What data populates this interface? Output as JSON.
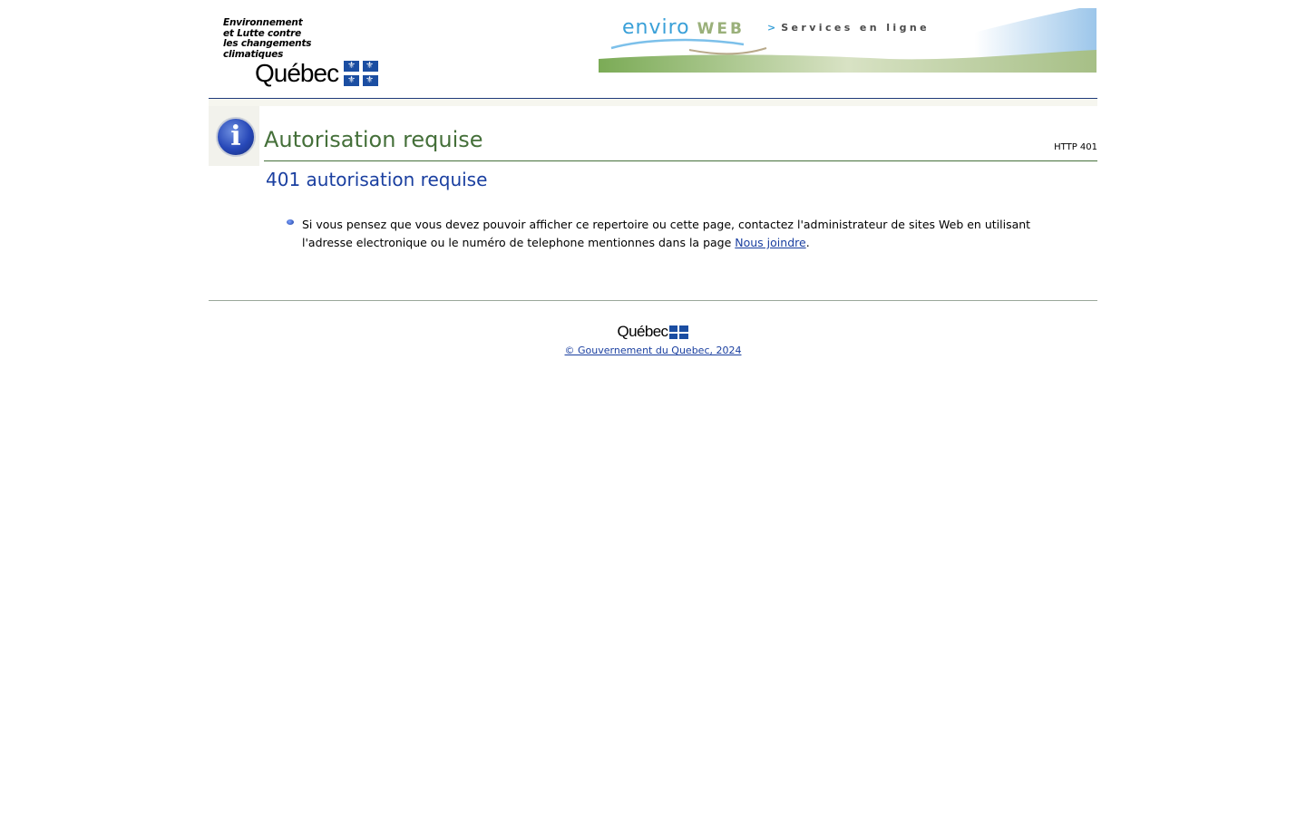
{
  "header": {
    "ministry_name": "Environnement\net Lutte contre\nles changements\nclimatiques",
    "ministry_lines": [
      "Environnement",
      "et Lutte contre",
      "les changements",
      "climatiques"
    ],
    "logo_word": "Québec",
    "banner_title_main": "enviro",
    "banner_title_web": "WEB",
    "banner_services_arrow": ">",
    "banner_services": "Services en ligne"
  },
  "main": {
    "title": "Autorisation requise",
    "http_code": "HTTP 401",
    "subtitle": "401 autorisation requise",
    "message_text": "Si vous pensez que vous devez pouvoir afficher ce repertoire ou cette page, contactez l'administrateur de sites Web en utilisant l'adresse electronique ou le numéro de telephone mentionnes dans la page ",
    "message_link": "Nous joindre",
    "message_end": "."
  },
  "footer": {
    "logo_word": "Québec",
    "copyright": "© Gouvernement du Quebec, 2024"
  },
  "colors": {
    "title_green": "#45703a",
    "subtitle_blue": "#1a3fa0",
    "header_rule": "#1f3a7a",
    "flag_blue": "#1b4ea2"
  },
  "icons": {
    "info": "info-icon",
    "bullet": "bullet-icon",
    "flag": "quebec-flag-icon"
  }
}
